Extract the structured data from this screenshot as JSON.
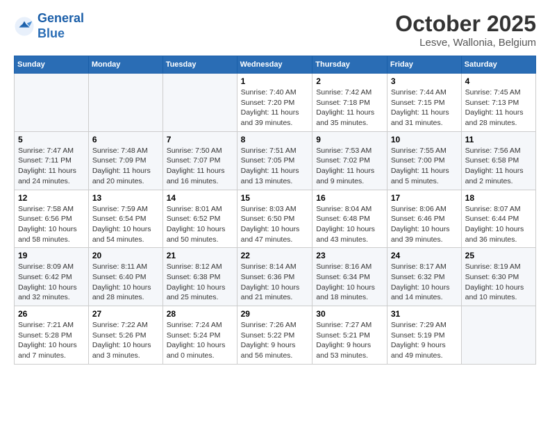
{
  "header": {
    "logo_line1": "General",
    "logo_line2": "Blue",
    "month": "October 2025",
    "location": "Lesve, Wallonia, Belgium"
  },
  "days_of_week": [
    "Sunday",
    "Monday",
    "Tuesday",
    "Wednesday",
    "Thursday",
    "Friday",
    "Saturday"
  ],
  "weeks": [
    [
      {
        "num": "",
        "info": ""
      },
      {
        "num": "",
        "info": ""
      },
      {
        "num": "",
        "info": ""
      },
      {
        "num": "1",
        "info": "Sunrise: 7:40 AM\nSunset: 7:20 PM\nDaylight: 11 hours and 39 minutes."
      },
      {
        "num": "2",
        "info": "Sunrise: 7:42 AM\nSunset: 7:18 PM\nDaylight: 11 hours and 35 minutes."
      },
      {
        "num": "3",
        "info": "Sunrise: 7:44 AM\nSunset: 7:15 PM\nDaylight: 11 hours and 31 minutes."
      },
      {
        "num": "4",
        "info": "Sunrise: 7:45 AM\nSunset: 7:13 PM\nDaylight: 11 hours and 28 minutes."
      }
    ],
    [
      {
        "num": "5",
        "info": "Sunrise: 7:47 AM\nSunset: 7:11 PM\nDaylight: 11 hours and 24 minutes."
      },
      {
        "num": "6",
        "info": "Sunrise: 7:48 AM\nSunset: 7:09 PM\nDaylight: 11 hours and 20 minutes."
      },
      {
        "num": "7",
        "info": "Sunrise: 7:50 AM\nSunset: 7:07 PM\nDaylight: 11 hours and 16 minutes."
      },
      {
        "num": "8",
        "info": "Sunrise: 7:51 AM\nSunset: 7:05 PM\nDaylight: 11 hours and 13 minutes."
      },
      {
        "num": "9",
        "info": "Sunrise: 7:53 AM\nSunset: 7:02 PM\nDaylight: 11 hours and 9 minutes."
      },
      {
        "num": "10",
        "info": "Sunrise: 7:55 AM\nSunset: 7:00 PM\nDaylight: 11 hours and 5 minutes."
      },
      {
        "num": "11",
        "info": "Sunrise: 7:56 AM\nSunset: 6:58 PM\nDaylight: 11 hours and 2 minutes."
      }
    ],
    [
      {
        "num": "12",
        "info": "Sunrise: 7:58 AM\nSunset: 6:56 PM\nDaylight: 10 hours and 58 minutes."
      },
      {
        "num": "13",
        "info": "Sunrise: 7:59 AM\nSunset: 6:54 PM\nDaylight: 10 hours and 54 minutes."
      },
      {
        "num": "14",
        "info": "Sunrise: 8:01 AM\nSunset: 6:52 PM\nDaylight: 10 hours and 50 minutes."
      },
      {
        "num": "15",
        "info": "Sunrise: 8:03 AM\nSunset: 6:50 PM\nDaylight: 10 hours and 47 minutes."
      },
      {
        "num": "16",
        "info": "Sunrise: 8:04 AM\nSunset: 6:48 PM\nDaylight: 10 hours and 43 minutes."
      },
      {
        "num": "17",
        "info": "Sunrise: 8:06 AM\nSunset: 6:46 PM\nDaylight: 10 hours and 39 minutes."
      },
      {
        "num": "18",
        "info": "Sunrise: 8:07 AM\nSunset: 6:44 PM\nDaylight: 10 hours and 36 minutes."
      }
    ],
    [
      {
        "num": "19",
        "info": "Sunrise: 8:09 AM\nSunset: 6:42 PM\nDaylight: 10 hours and 32 minutes."
      },
      {
        "num": "20",
        "info": "Sunrise: 8:11 AM\nSunset: 6:40 PM\nDaylight: 10 hours and 28 minutes."
      },
      {
        "num": "21",
        "info": "Sunrise: 8:12 AM\nSunset: 6:38 PM\nDaylight: 10 hours and 25 minutes."
      },
      {
        "num": "22",
        "info": "Sunrise: 8:14 AM\nSunset: 6:36 PM\nDaylight: 10 hours and 21 minutes."
      },
      {
        "num": "23",
        "info": "Sunrise: 8:16 AM\nSunset: 6:34 PM\nDaylight: 10 hours and 18 minutes."
      },
      {
        "num": "24",
        "info": "Sunrise: 8:17 AM\nSunset: 6:32 PM\nDaylight: 10 hours and 14 minutes."
      },
      {
        "num": "25",
        "info": "Sunrise: 8:19 AM\nSunset: 6:30 PM\nDaylight: 10 hours and 10 minutes."
      }
    ],
    [
      {
        "num": "26",
        "info": "Sunrise: 7:21 AM\nSunset: 5:28 PM\nDaylight: 10 hours and 7 minutes."
      },
      {
        "num": "27",
        "info": "Sunrise: 7:22 AM\nSunset: 5:26 PM\nDaylight: 10 hours and 3 minutes."
      },
      {
        "num": "28",
        "info": "Sunrise: 7:24 AM\nSunset: 5:24 PM\nDaylight: 10 hours and 0 minutes."
      },
      {
        "num": "29",
        "info": "Sunrise: 7:26 AM\nSunset: 5:22 PM\nDaylight: 9 hours and 56 minutes."
      },
      {
        "num": "30",
        "info": "Sunrise: 7:27 AM\nSunset: 5:21 PM\nDaylight: 9 hours and 53 minutes."
      },
      {
        "num": "31",
        "info": "Sunrise: 7:29 AM\nSunset: 5:19 PM\nDaylight: 9 hours and 49 minutes."
      },
      {
        "num": "",
        "info": ""
      }
    ]
  ]
}
